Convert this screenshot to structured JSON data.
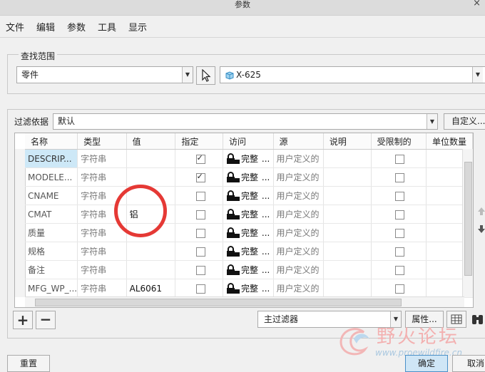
{
  "window": {
    "title": "参数",
    "close_glyph": "×"
  },
  "menu": [
    "文件",
    "编辑",
    "参数",
    "工具",
    "显示"
  ],
  "search_scope": {
    "label": "查找范围",
    "type_value": "零件",
    "model_value": "X-625"
  },
  "filter": {
    "label": "过滤依据",
    "value": "默认",
    "customize_label": "自定义..."
  },
  "table": {
    "columns": [
      "名称",
      "类型",
      "值",
      "指定",
      "访问",
      "源",
      "说明",
      "受限制的",
      "单位数量"
    ],
    "rows": [
      {
        "name": "DESCRIP...",
        "type": "字符串",
        "value": "",
        "designated": true,
        "access": "完整",
        "access_more": "...",
        "source": "用户定义的",
        "desc": "",
        "restricted": false,
        "selected": true
      },
      {
        "name": "MODELE...",
        "type": "字符串",
        "value": "",
        "designated": true,
        "access": "完整",
        "access_more": "...",
        "source": "用户定义的",
        "desc": "",
        "restricted": false,
        "selected": false
      },
      {
        "name": "CNAME",
        "type": "字符串",
        "value": "",
        "designated": false,
        "access": "完整",
        "access_more": "...",
        "source": "用户定义的",
        "desc": "",
        "restricted": false,
        "selected": false
      },
      {
        "name": "CMAT",
        "type": "字符串",
        "value": "铝",
        "designated": false,
        "access": "完整",
        "access_more": "...",
        "source": "用户定义的",
        "desc": "",
        "restricted": false,
        "selected": false
      },
      {
        "name": "质量",
        "type": "字符串",
        "value": "",
        "designated": false,
        "access": "完整",
        "access_more": "...",
        "source": "用户定义的",
        "desc": "",
        "restricted": false,
        "selected": false
      },
      {
        "name": "规格",
        "type": "字符串",
        "value": "",
        "designated": false,
        "access": "完整",
        "access_more": "...",
        "source": "用户定义的",
        "desc": "",
        "restricted": false,
        "selected": false
      },
      {
        "name": "备注",
        "type": "字符串",
        "value": "",
        "designated": false,
        "access": "完整",
        "access_more": "...",
        "source": "用户定义的",
        "desc": "",
        "restricted": false,
        "selected": false
      },
      {
        "name": "MFG_WP_...",
        "type": "字符串",
        "value": "AL6061",
        "designated": false,
        "access": "完整",
        "access_more": "...",
        "source": "用户定义的",
        "desc": "",
        "restricted": false,
        "selected": false
      }
    ]
  },
  "bottom": {
    "add_glyph": "+",
    "remove_glyph": "−",
    "main_filter_value": "主过滤器",
    "properties_label": "属性..."
  },
  "footer": {
    "reset": "重置",
    "ok": "确定",
    "cancel": "取消"
  },
  "watermark": {
    "text": "野火论坛",
    "url": "www.proewildfire.cn"
  },
  "colors": {
    "selected_row": "#cde8f7",
    "annotation": "#e53935",
    "ok_button": "#cfe6f6"
  }
}
